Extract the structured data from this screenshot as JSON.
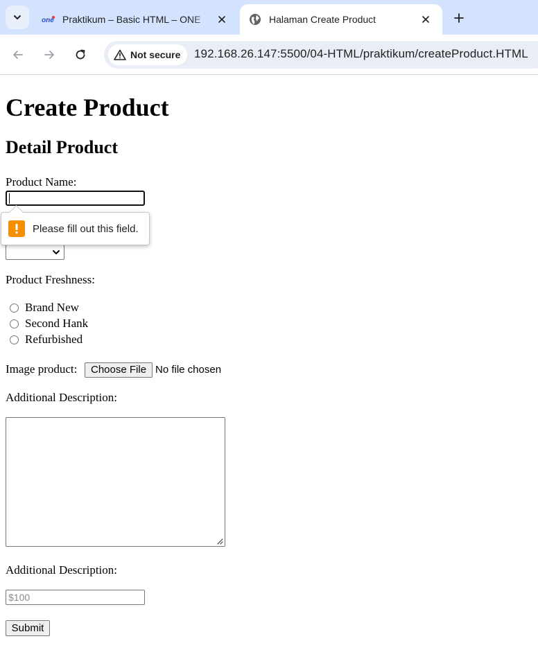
{
  "browser": {
    "tabs": [
      {
        "title": "Praktikum – Basic HTML – ONE",
        "favicon": "one-logo-icon",
        "active": false
      },
      {
        "title": "Halaman Create Product",
        "favicon": "globe-icon",
        "active": true
      }
    ],
    "security_label": "Not secure",
    "url": "192.168.26.147:5500/04-HTML/praktikum/createProduct.HTML"
  },
  "page": {
    "title": "Create Product",
    "section_title": "Detail Product",
    "product_name_label": "Product Name:",
    "freshness_label": "Product Freshness:",
    "freshness_options": [
      "Brand New",
      "Second Hank",
      "Refurbished"
    ],
    "image_label": "Image product:",
    "file_button": "Choose File",
    "file_status": "No file chosen",
    "description_label": "Additional Description:",
    "price_label": "Additional Description:",
    "price_placeholder": "$100",
    "submit_label": "Submit"
  },
  "validation": {
    "message": "Please fill out this field."
  },
  "colors": {
    "tabbar": "#d3e3fd",
    "omnibox": "#e9eef6",
    "warning": "#f48f00"
  }
}
